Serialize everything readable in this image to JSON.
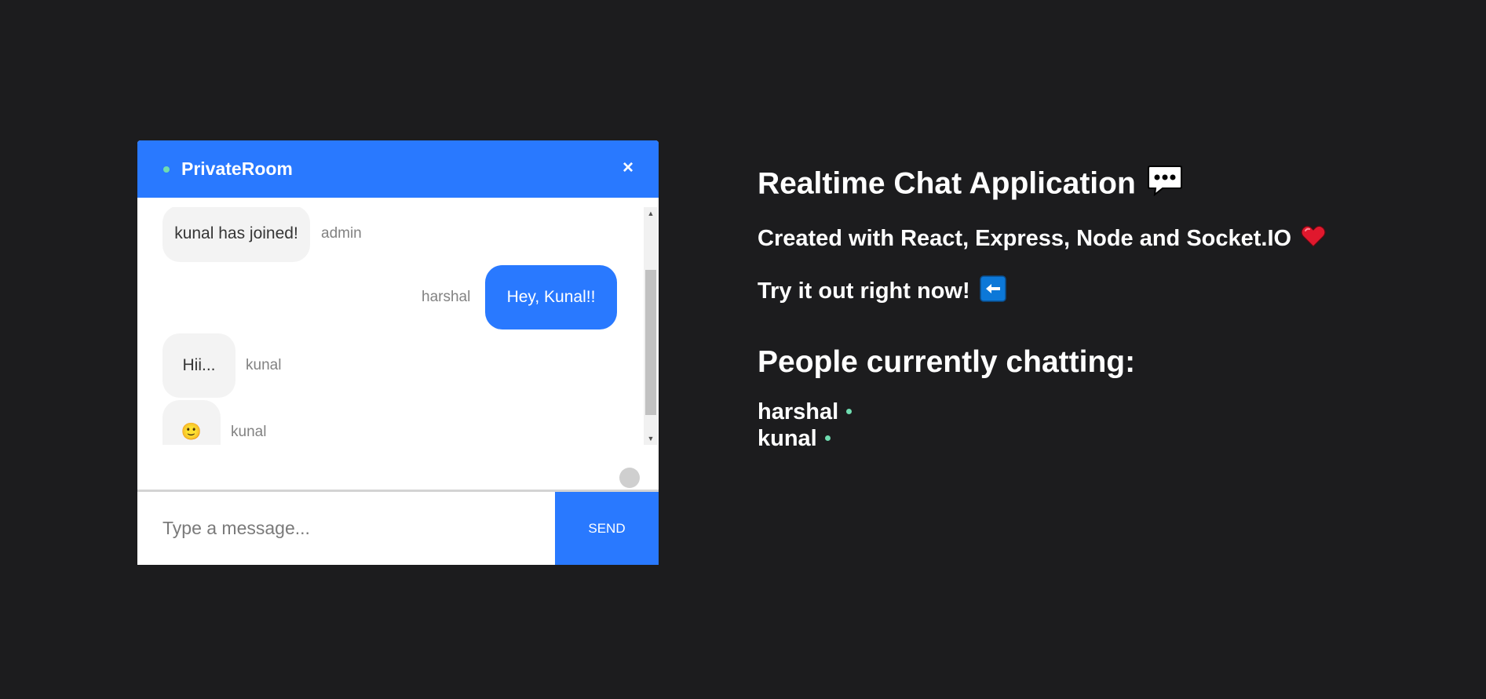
{
  "chat": {
    "room_name": "PrivateRoom",
    "close_label": "×",
    "messages": [
      {
        "text": "kunal has joined!",
        "sender": "admin",
        "own": false
      },
      {
        "text": "Hey, Kunal!!",
        "sender": "harshal",
        "own": true
      },
      {
        "text": "Hii...",
        "sender": "kunal",
        "own": false
      },
      {
        "text": "🙂",
        "sender": "kunal",
        "own": false
      }
    ],
    "input_placeholder": "Type a message...",
    "send_label": "SEND"
  },
  "info": {
    "title": "Realtime Chat Application",
    "subtitle": "Created with React, Express, Node and Socket.IO",
    "cta": "Try it out right now!",
    "people_title": "People currently chatting:",
    "people": [
      "harshal",
      "kunal"
    ]
  },
  "colors": {
    "background": "#1c1c1e",
    "accent": "#2979ff",
    "online": "#6fdcb0",
    "bubble_gray": "#f3f3f3"
  },
  "icons": {
    "title_icon": "speech-bubble-icon",
    "subtitle_icon": "heart-icon",
    "cta_icon": "left-arrow-icon"
  }
}
